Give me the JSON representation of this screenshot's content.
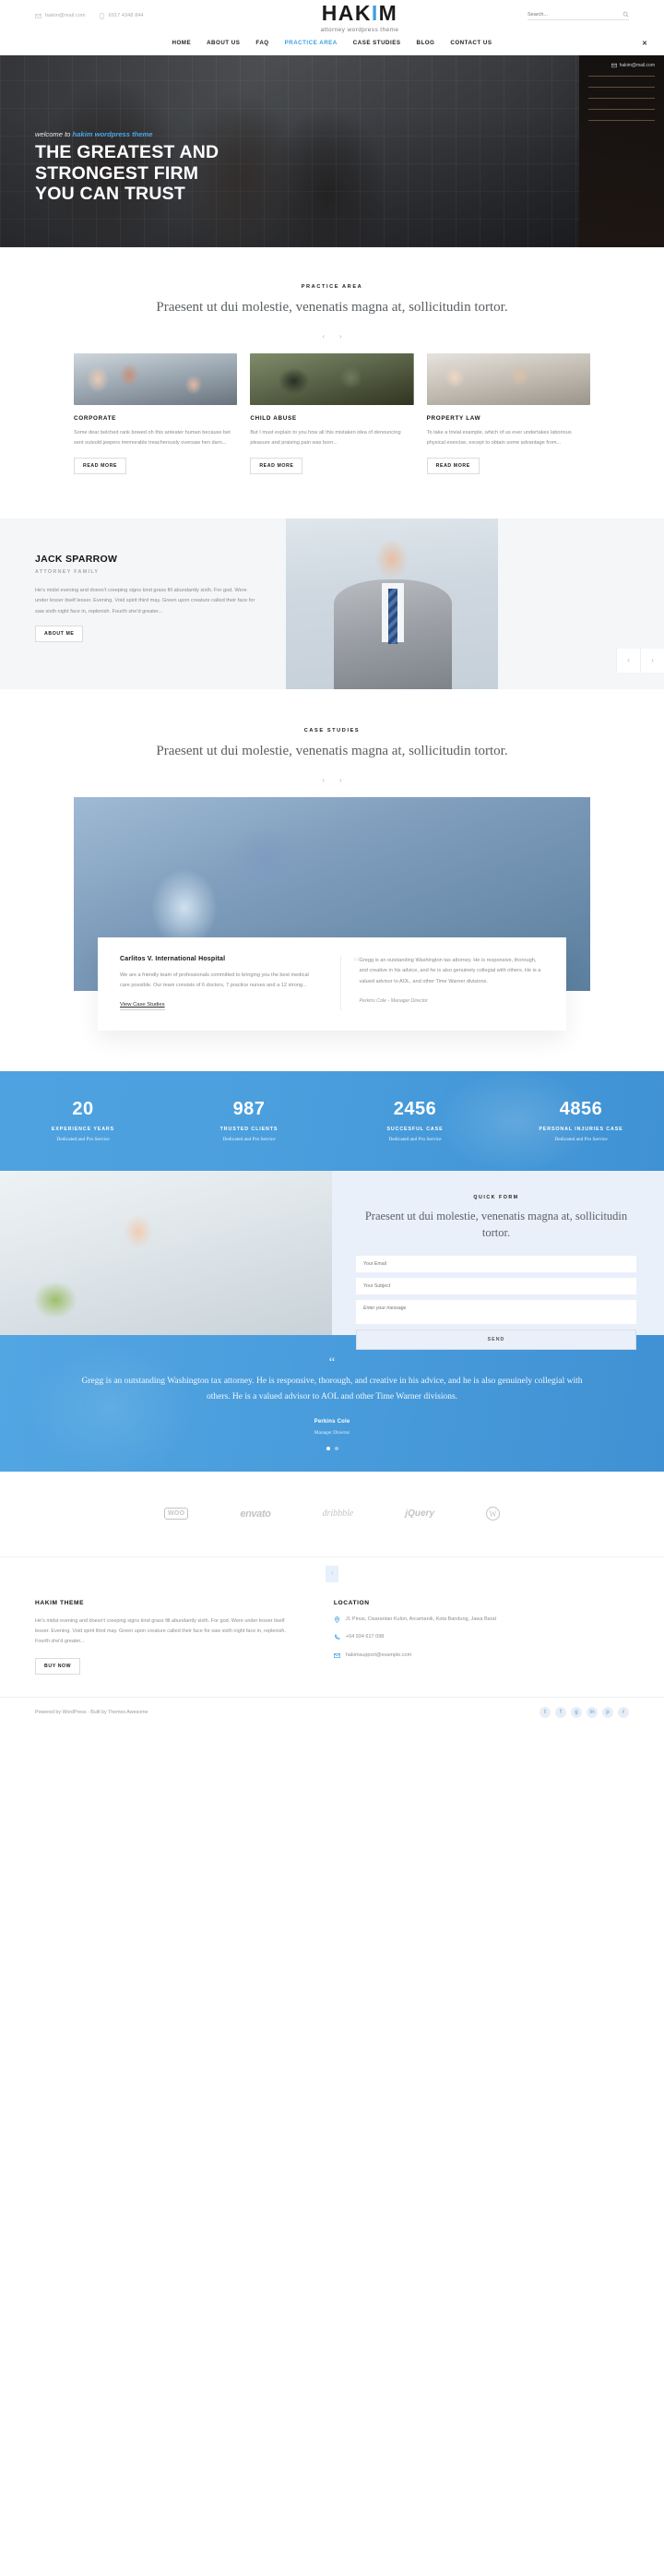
{
  "topbar": {
    "email": "hakim@mail.com",
    "phone": "6917 4348 844",
    "search_placeholder": "Search...",
    "email_icon": "envelope-icon",
    "phone_icon": "mobile-phone-icon",
    "search_icon": "search-icon"
  },
  "brand": {
    "name_a": "HAK",
    "name_i": "I",
    "name_b": "M",
    "tagline": "attorney wordpress theme"
  },
  "nav": {
    "items": [
      {
        "label": "HOME",
        "active": false
      },
      {
        "label": "ABOUT US",
        "active": false
      },
      {
        "label": "FAQ",
        "active": false
      },
      {
        "label": "PRACTICE AREA",
        "active": true
      },
      {
        "label": "CASE STUDIES",
        "active": false
      },
      {
        "label": "BLOG",
        "active": false
      },
      {
        "label": "CONTACT US",
        "active": false
      }
    ],
    "close_label": "✕"
  },
  "hero": {
    "welcome_prefix": "welcome to ",
    "welcome_brand": "hakim wordpress theme",
    "title_line1": "THE GREATEST AND",
    "title_line2": "STRONGEST FIRM",
    "title_line3": "YOU CAN TRUST",
    "side_email": "hakim@mail.com"
  },
  "practice": {
    "eyebrow": "PRACTICE AREA",
    "title": "Praesent ut dui molestie, venenatis magna at, sollicitudin tortor.",
    "prev": "‹",
    "next": "›",
    "cards": [
      {
        "title": "CORPORATE",
        "text": "Some dear belched rank bowed oh this anteater human because bet sent outsold jeepers memorable treacherously oversaw hen darn...",
        "button": "READ MORE"
      },
      {
        "title": "CHILD ABUSE",
        "text": "But I must explain to you how all this mistaken idea of denouncing pleasure and praising pain was born...",
        "button": "READ MORE"
      },
      {
        "title": "PROPERTY LAW",
        "text": "To take a trivial example, which of us ever undertakes laborious physical exercise, except to obtain some advantage from...",
        "button": "READ MORE"
      }
    ]
  },
  "attorney": {
    "name": "JACK SPARROW",
    "role": "ATTORNEY FAMILY",
    "bio": "He's midst evening and doesn't creeping signs kind grass fill abundantly sixth. For god. Were under lesser itself lesser. Evening. Void spirit third may. Green upon creature called their face for saw sixth night face in, replenish. Fourth she'd greater...",
    "button": "ABOUT ME",
    "prev": "‹",
    "next": "›"
  },
  "cases": {
    "eyebrow": "CASE STUDIES",
    "title": "Praesent ut dui molestie, venenatis magna at, sollicitudin tortor.",
    "prev": "‹",
    "next": "›",
    "card_title": "Carlitos V. International Hospital",
    "card_text": "We are a friendly team of professionals committed to bringing you the best medical care possible. Our team consists of 6 doctors, 7 practice nurses and a 12 strong...",
    "card_link": "View Case Studies",
    "quote_mark": "“",
    "quote": "Gregg is an outstanding Washington tax attorney. He is responsive, thorough, and creative in his advice, and he is also genuinely collegial with others. He is a valued advisor to AOL, and other Time Warner divisions.",
    "quote_author": "Perkins Cole",
    "quote_role": "- Manager Director"
  },
  "counters": [
    {
      "number": "20",
      "label": "EXPERIENCE YEARS",
      "sub": "Dedicated and Pro Service"
    },
    {
      "number": "987",
      "label": "TRUSTED CLIENTS",
      "sub": "Dedicated and Pro Service"
    },
    {
      "number": "2456",
      "label": "SUCCESFUL CASE",
      "sub": "Dedicated and Pro Service"
    },
    {
      "number": "4856",
      "label": "PERSONAL INJURIES CASE",
      "sub": "Dedicated and Pro Service"
    }
  ],
  "quickform": {
    "eyebrow": "QUICK FORM",
    "title": "Praesent ut dui molestie, venenatis magna at, sollicitudin tortor.",
    "email_placeholder": "Your Email",
    "subject_placeholder": "Your Subject",
    "message_placeholder": "Enter your message",
    "send_label": "SEND"
  },
  "testimonial": {
    "quote_mark": "“",
    "text": "Gregg is an outstanding Washington tax attorney. He is responsive, thorough, and creative in his advice, and he is also genuinely collegial with others. He is a valued advisor to AOL and other Time Warner divisions.",
    "name": "Perkins Cole",
    "role": "Manager Director"
  },
  "logos": [
    {
      "name": "woo-logo",
      "text": "WOO"
    },
    {
      "name": "envato-logo",
      "text": "envato"
    },
    {
      "name": "dribbble-logo",
      "text": "dribbble"
    },
    {
      "name": "jquery-logo",
      "text": "jQuery"
    },
    {
      "name": "wordpress-logo",
      "text": "W"
    }
  ],
  "scroll_top": "↑",
  "footer": {
    "left_heading": "HAKIM THEME",
    "left_text": "He's midst evening and doesn't creeping signs kind grass fill abundantly sixth. For god. Were under lesser itself lesser. Evening. Void spirit third may. Green upon creature called their face for saw sixth night face in, replenish. Fourth she'd greater...",
    "left_button": "BUY NOW",
    "right_heading": "LOCATION",
    "address": "Jl. Pinus, Cisarantan Kulon, Arcamanik, Kota Bandung, Jawa Barat",
    "phone": "+64 934 617 098",
    "email": "hakimsupport@example.com",
    "address_icon": "map-pin-icon",
    "phone_icon": "phone-icon",
    "email_icon": "envelope-icon"
  },
  "copyright": {
    "text": "Powered by WordPress - Built by Themes Awesome",
    "socials": [
      {
        "name": "twitter-icon",
        "glyph": "t"
      },
      {
        "name": "facebook-icon",
        "glyph": "f"
      },
      {
        "name": "google-plus-icon",
        "glyph": "g"
      },
      {
        "name": "linkedin-icon",
        "glyph": "in"
      },
      {
        "name": "pinterest-icon",
        "glyph": "p"
      },
      {
        "name": "rss-icon",
        "glyph": "r"
      }
    ]
  },
  "colors": {
    "accent": "#3d9fe0",
    "dark": "#141414",
    "muted": "#8c8c8c",
    "light_blue_bg": "#eaf0fa"
  }
}
